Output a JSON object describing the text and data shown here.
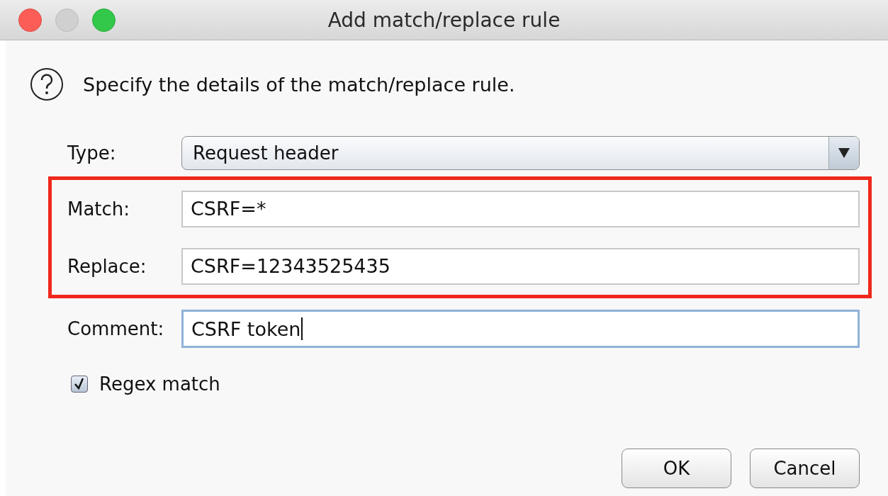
{
  "window": {
    "title": "Add match/replace rule"
  },
  "message": "Specify the details of the match/replace rule.",
  "type_field": {
    "label": "Type:",
    "value": "Request header"
  },
  "fields": [
    {
      "label": "Match:",
      "value": "CSRF=*",
      "highlighted": true,
      "focused": false
    },
    {
      "label": "Replace:",
      "value": "CSRF=12343525435",
      "highlighted": true,
      "focused": false
    },
    {
      "label": "Comment:",
      "value": "CSRF token",
      "highlighted": false,
      "focused": true
    }
  ],
  "regex": {
    "label": "Regex match",
    "checked": true
  },
  "buttons": [
    "OK",
    "Cancel"
  ]
}
